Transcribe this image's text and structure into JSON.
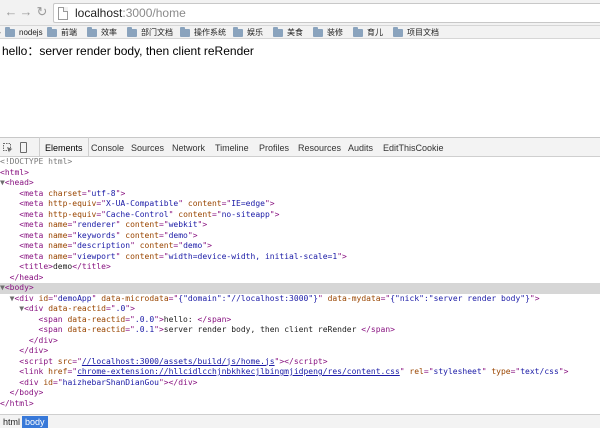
{
  "browser": {
    "url_host": "localhost",
    "url_path": ":3000/home",
    "bookmarks": [
      "nodejs",
      "前端",
      "效率",
      "部门文档",
      "操作系统",
      "娱乐",
      "美食",
      "装修",
      "育儿",
      "项目文档"
    ]
  },
  "page": {
    "body_text": "hello：server render body, then client reRender"
  },
  "devtools": {
    "tabs": [
      "Elements",
      "Console",
      "Sources",
      "Network",
      "Timeline",
      "Profiles",
      "Resources",
      "Audits",
      "EditThisCookie"
    ],
    "active_tab": "Elements",
    "breadcrumbs": [
      "html",
      "body"
    ],
    "active_breadcrumb": "body",
    "dom": {
      "doctype": "<!DOCTYPE html>",
      "meta_charset": "utf-8",
      "meta_compat_equiv": "X-UA-Compatible",
      "meta_compat_content": "IE=edge",
      "meta_cache_equiv": "Cache-Control",
      "meta_cache_content": "no-siteapp",
      "meta_renderer_name": "renderer",
      "meta_renderer_content": "webkit",
      "meta_keywords_name": "keywords",
      "meta_keywords_content": "demo",
      "meta_desc_name": "description",
      "meta_desc_content": "demo",
      "meta_viewport_name": "viewport",
      "meta_viewport_content": "width=device-width, initial-scale=1",
      "title_text": "demo",
      "demo_id": "demoApp",
      "demo_microdata": "{\"domain\":\"//localhost:3000\"}",
      "demo_mydata": "{\"nick\":\"server render body\"}",
      "reactid_root": ".0",
      "reactid_span0": ".0.0",
      "span0_text": "hello: ",
      "reactid_span1": ".0.1",
      "span1_text": "server render body, then client reRender ",
      "script_src": "//localhost:3000/assets/build/js/home.js",
      "link_href": "chrome-extension://hllcidlcchjnbkhkecjlbingmjidpeng/res/content.css",
      "link_rel": "stylesheet",
      "link_type": "text/css",
      "last_div_id": "haizhebarShanDianGou"
    }
  }
}
